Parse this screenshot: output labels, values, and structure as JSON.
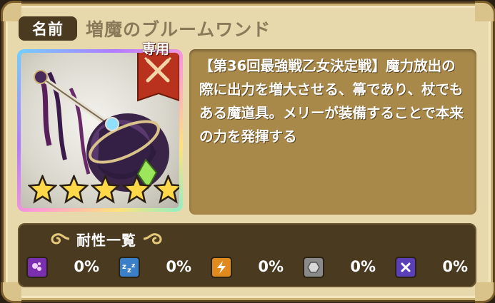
{
  "header": {
    "name_label": "名前",
    "item_name": "増魔のブルームワンド"
  },
  "portrait": {
    "badge_label": "専用",
    "star_count": 5,
    "icon": "magic-staff-icon"
  },
  "description": {
    "text": "【第36回最強戦乙女決定戦】魔力放出の際に出力を増大させる、箒であり、杖でもある魔道具。メリーが装備することで本来の力を発揮する"
  },
  "resistances": {
    "title": "耐性一覧",
    "items": [
      {
        "icon": "poison-icon",
        "value": "0%",
        "color": "#7a2fb0"
      },
      {
        "icon": "sleep-icon",
        "value": "0%",
        "color": "#3a7fc7"
      },
      {
        "icon": "paralysis-icon",
        "value": "0%",
        "color": "#e08a1e"
      },
      {
        "icon": "petrify-icon",
        "value": "0%",
        "color": "#8a8a8a"
      },
      {
        "icon": "seal-icon",
        "value": "0%",
        "color": "#5a3fb8"
      }
    ]
  },
  "colors": {
    "frame": "#e8d9ad",
    "panel_dark": "#4a3a20",
    "desc_panel": "#a8894a",
    "badge_red": "#b8321e"
  }
}
